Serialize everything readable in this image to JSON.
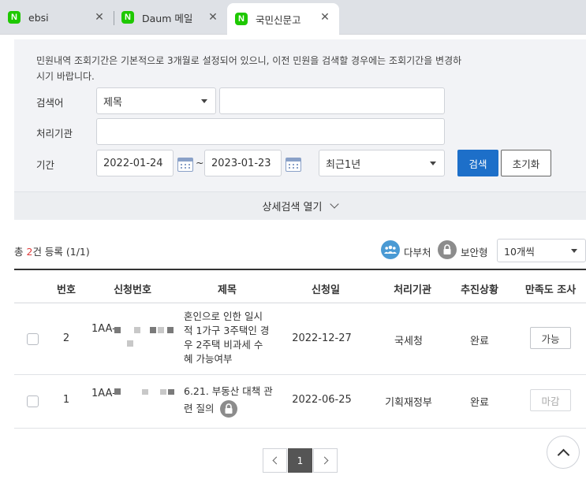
{
  "tabs": [
    {
      "label": "ebsi",
      "favicon": "N",
      "active": false
    },
    {
      "label": "Daum 메일",
      "favicon": "N",
      "active": false
    },
    {
      "label": "국민신문고",
      "favicon": "N",
      "active": true
    }
  ],
  "search": {
    "notice": "민원내역 조회기간은 기본적으로 3개월로 설정되어 있으니, 이전 민원을 검색할 경우에는 조회기간을 변경하시기 바랍니다.",
    "keyword_label": "검색어",
    "keyword_type": "제목",
    "keyword_value": "",
    "agency_label": "처리기관",
    "agency_value": "",
    "period_label": "기간",
    "date_from": "2022-01-24",
    "date_to": "2023-01-23",
    "date_sep": "~",
    "period_preset": "최근1년",
    "search_button": "검색",
    "reset_button": "초기화",
    "detail_toggle": "상세검색 열기"
  },
  "results": {
    "count_prefix": "총 ",
    "count_number": "2",
    "count_suffix": "건 등록 (1/1)",
    "legend_multi": "다부처",
    "legend_secure": "보안형",
    "per_page": "10개씩"
  },
  "table": {
    "headers": [
      "번호",
      "신청번호",
      "제목",
      "신청일",
      "처리기관",
      "추진상황",
      "만족도 조사"
    ],
    "rows": [
      {
        "no": "2",
        "app_no": "1AA-",
        "title_lines": [
          "혼인으로 인한 일시",
          "적 1가구 3주택인 경",
          "우 2주택 비과세 수",
          "혜 가능여부"
        ],
        "date": "2022-12-27",
        "agency": "국세청",
        "status": "완료",
        "survey": "가능",
        "secure": false
      },
      {
        "no": "1",
        "app_no": "1AA-",
        "title_lines": [
          "6.21. 부동산 대책 관",
          "련 질의"
        ],
        "date": "2022-06-25",
        "agency": "기획재정부",
        "status": "완료",
        "survey": "마감",
        "secure": true
      }
    ]
  },
  "pagination": {
    "current": "1"
  },
  "colors": {
    "accent": "#1d6fc9",
    "count_highlight": "#e03c3c",
    "tab_favicon": "#1ec800",
    "legend_multi": "#4a9ad4",
    "legend_secure": "#8c8c8c"
  },
  "icons": [
    "naver-favicon-icon",
    "close-icon",
    "calendar-icon",
    "chevron-down-icon",
    "people-icon",
    "lock-icon",
    "chevron-left-icon",
    "chevron-right-icon",
    "scroll-top-icon"
  ]
}
